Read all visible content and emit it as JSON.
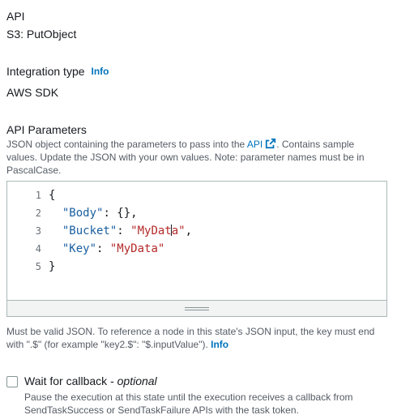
{
  "api": {
    "label": "API",
    "value": "S3: PutObject"
  },
  "integration": {
    "label": "Integration type",
    "info_link": "Info",
    "value": "AWS SDK"
  },
  "params": {
    "label": "API Parameters",
    "desc_before": "JSON object containing the parameters to pass into the ",
    "api_link": "API",
    "desc_after": ". Contains sample values. Update the JSON with your own values. Note: parameter names must be in PascalCase."
  },
  "editor": {
    "line_numbers": [
      "1",
      "2",
      "3",
      "4",
      "5"
    ],
    "line1": "{",
    "line2_key": "\"Body\"",
    "line2_rest": ": {},",
    "line3_key": "\"Bucket\"",
    "line3_sep": ": ",
    "line3_val_a": "\"MyDat",
    "line3_val_b": "a\"",
    "line3_end": ",",
    "line4_key": "\"Key\"",
    "line4_sep": ": ",
    "line4_val": "\"MyData\"",
    "line5": "}"
  },
  "json_note": {
    "text": "Must be valid JSON. To reference a node in this state's JSON input, the key must end with \".$\" (for example \"key2.$\": \"$.inputValue\"). ",
    "info_link": "Info"
  },
  "callback": {
    "title": "Wait for callback - ",
    "optional": "optional",
    "checked": false,
    "desc": "Pause the execution at this state until the execution receives a callback from SendTaskSuccess or SendTaskFailure APIs with the task token."
  }
}
